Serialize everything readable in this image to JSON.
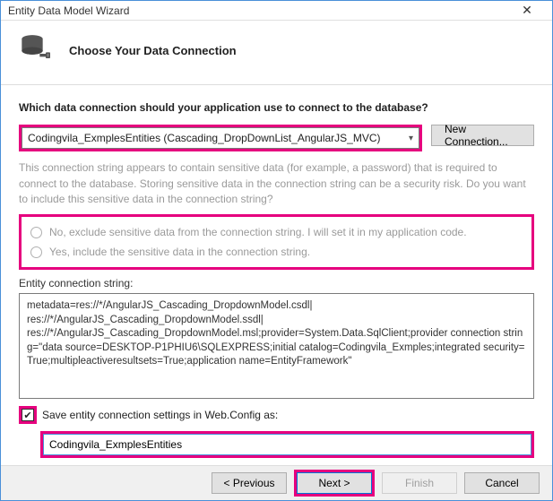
{
  "titlebar": {
    "title": "Entity Data Model Wizard"
  },
  "header": {
    "heading": "Choose Your Data Connection"
  },
  "prompt": "Which data connection should your application use to connect to the database?",
  "combo": {
    "selected": "Codingvila_ExmplesEntities (Cascading_DropDownList_AngularJS_MVC)"
  },
  "buttons": {
    "new_connection": "New Connection..."
  },
  "warning_text": "This connection string appears to contain sensitive data (for example, a password) that is required to connect to the database. Storing sensitive data in the connection string can be a security risk. Do you want to include this sensitive data in the connection string?",
  "radios": {
    "exclude": "No, exclude sensitive data from the connection string. I will set it in my application code.",
    "include": "Yes, include the sensitive data in the connection string."
  },
  "conn_label": "Entity connection string:",
  "conn_string": "metadata=res://*/AngularJS_Cascading_DropdownModel.csdl|\nres://*/AngularJS_Cascading_DropdownModel.ssdl|\nres://*/AngularJS_Cascading_DropdownModel.msl;provider=System.Data.SqlClient;provider connection string=\"data source=DESKTOP-P1PHIU6\\SQLEXPRESS;initial catalog=Codingvila_Exmples;integrated security=True;multipleactiveresultsets=True;application name=EntityFramework\"",
  "save_checkbox": {
    "checked": true,
    "label": "Save entity connection settings in Web.Config as:"
  },
  "settings_name": "Codingvila_ExmplesEntities",
  "footer": {
    "previous": "< Previous",
    "next": "Next >",
    "finish": "Finish",
    "cancel": "Cancel"
  }
}
